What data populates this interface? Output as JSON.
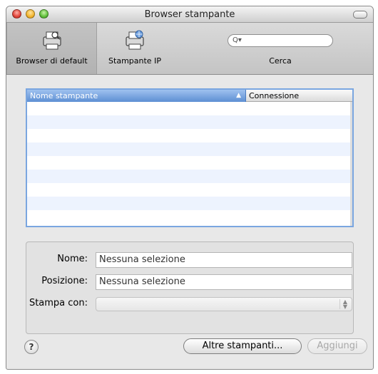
{
  "window": {
    "title": "Browser stampante"
  },
  "toolbar": {
    "default_browser_label": "Browser di default",
    "ip_printer_label": "Stampante IP",
    "search_placeholder": "",
    "search_label": "Cerca"
  },
  "printer_table": {
    "columns": [
      "Nome stampante",
      "Connessione"
    ],
    "sort_indicator": "▲",
    "rows": []
  },
  "details": {
    "name_label": "Nome:",
    "name_value": "Nessuna selezione",
    "location_label": "Posizione:",
    "location_value": "Nessuna selezione",
    "print_using_label": "Stampa con:",
    "print_using_value": ""
  },
  "footer": {
    "help_symbol": "?",
    "more_printers_label": "Altre stampanti...",
    "add_label": "Aggiungi"
  },
  "colors": {
    "selection_header": "#5d8fd3",
    "table_focus": "#7aa6e0",
    "alternate_row": "#edf3fe"
  }
}
